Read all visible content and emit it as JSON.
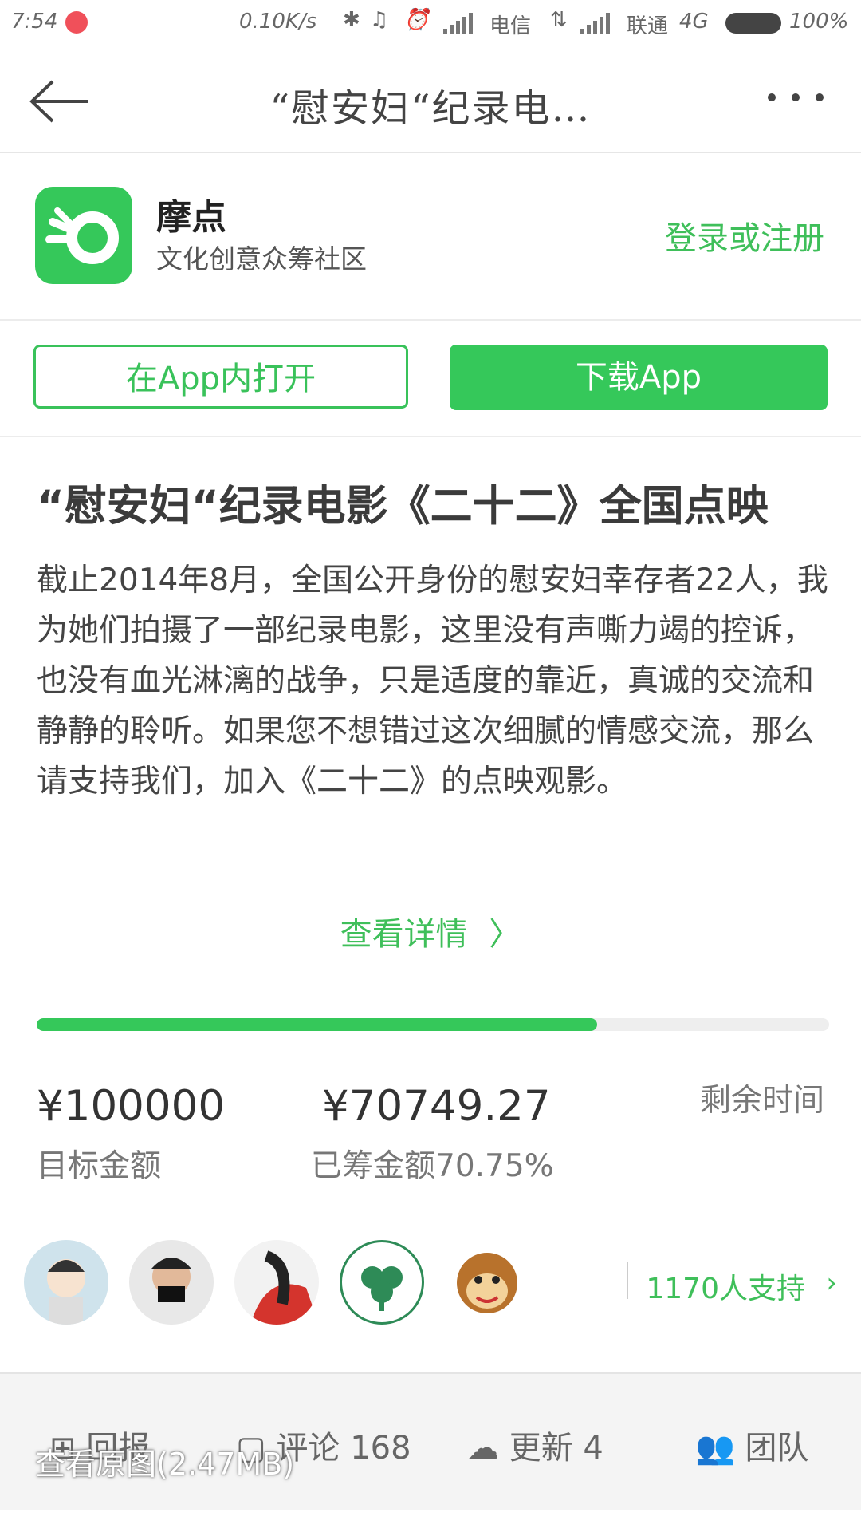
{
  "status_bar": {
    "time": "7:54",
    "net_speed": "0.10K/s",
    "carrier1": "电信",
    "carrier2": "联通",
    "network": "4G",
    "battery": "100%"
  },
  "nav": {
    "title": "“慰安妇“纪录电…",
    "more_icon": "more-dots-icon",
    "back_icon": "back-arrow-icon"
  },
  "app": {
    "name": "摩点",
    "subtitle": "文化创意众筹社区",
    "login_label": "登录或注册",
    "accent_color": "#35c85a"
  },
  "actions": {
    "open_in_app": "在App内打开",
    "download_app": "下载App"
  },
  "project": {
    "title": "“慰安妇“纪录电影《二十二》全国点映",
    "description": "截止2014年8月，全国公开身份的慰安妇幸存者22人，我为她们拍摄了一部纪录电影，这里没有声嘶力竭的控诉，也没有血光淋漓的战争，只是适度的靠近，真诚的交流和静静的聆听。如果您不想错过这次细腻的情感交流，那么请支持我们，加入《二十二》的点映观影。",
    "more_label": "查看详情"
  },
  "funding": {
    "progress": 0.7075,
    "target_value": "¥100000",
    "target_label": "目标金额",
    "raised_value": "¥70749.27",
    "raised_label": "已筹金额70.75%",
    "remaining_label": "剩余时间"
  },
  "supporters": {
    "count_label": "1170人支持"
  },
  "bottom_tabs": {
    "rewards": "回报",
    "comments": "评论 168",
    "updates": "更新 4",
    "team": "团队"
  },
  "overlay": {
    "view_original": "查看原图(2.47MB)"
  }
}
